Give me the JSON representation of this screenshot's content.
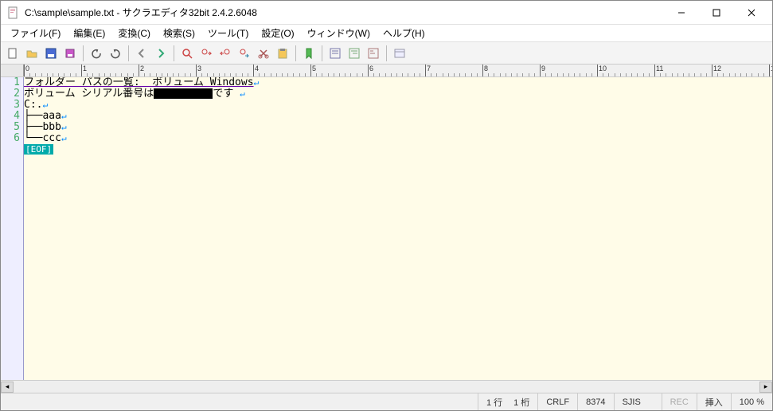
{
  "title": "C:\\sample\\sample.txt - サクラエディタ32bit 2.4.2.6048",
  "menus": [
    "ファイル(F)",
    "編集(E)",
    "変換(C)",
    "検索(S)",
    "ツール(T)",
    "設定(O)",
    "ウィンドウ(W)",
    "ヘルプ(H)"
  ],
  "toolbar_icons": [
    "new-icon",
    "open-icon",
    "save-icon",
    "save-all-icon",
    "sep",
    "undo-icon",
    "redo-icon",
    "sep",
    "back-icon",
    "forward-icon",
    "sep",
    "find-icon",
    "find-next-icon",
    "find-prev-icon",
    "replace-icon",
    "cut-icon",
    "paste-icon",
    "sep",
    "bookmark-icon",
    "sep",
    "outline-1-icon",
    "outline-2-icon",
    "outline-3-icon",
    "sep",
    "settings-icon"
  ],
  "lines": {
    "l1": "フォルダー パスの一覧:  ボリューム Windows",
    "l2a": "ボリューム シリアル番号は",
    "l2b": "です ",
    "l3": "C:.",
    "l4": "├──aaa",
    "l5": "├──bbb",
    "l6": "└──ccc",
    "eof": "[EOF]"
  },
  "ruler_majors": [
    0,
    1,
    2,
    3,
    4,
    5,
    6,
    7,
    8,
    9,
    10,
    11,
    12
  ],
  "status": {
    "pos": "1 行 　1 桁",
    "eol": "CRLF",
    "code": "8374",
    "enc": "SJIS",
    "rec": "REC",
    "ins": "挿入",
    "zoom": "100 %"
  },
  "win": {
    "min": "—",
    "max": "▢",
    "close": "✕"
  }
}
